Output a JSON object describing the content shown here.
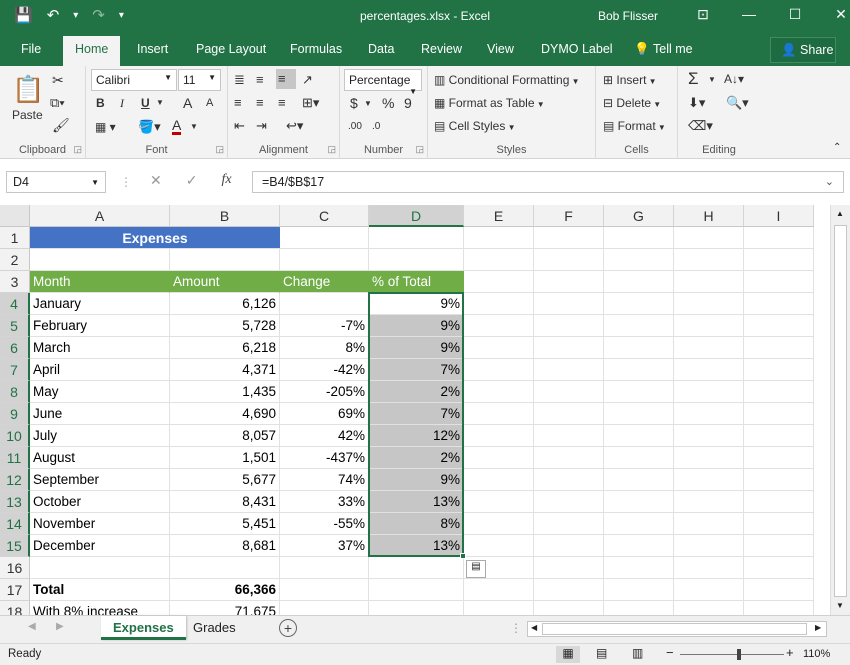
{
  "window": {
    "title": "percentages.xlsx - Excel",
    "user": "Bob Flisser",
    "controls": [
      "⊡",
      "—",
      "☐",
      "✕"
    ]
  },
  "qat": {
    "save": "💾",
    "undo": "↶",
    "undo_drop": "▾",
    "redo": "↷",
    "more": "▾"
  },
  "ribbon_tabs": [
    "File",
    "Home",
    "Insert",
    "Page Layout",
    "Formulas",
    "Data",
    "Review",
    "View",
    "DYMO Label",
    "Tell me"
  ],
  "tell_me_icon": "💡",
  "share_label": "Share",
  "ribbon": {
    "clipboard": {
      "label": "Clipboard",
      "paste": "Paste"
    },
    "font": {
      "label": "Font",
      "name": "Calibri",
      "size": "11",
      "bold": "B",
      "italic": "I",
      "underline": "U",
      "grow": "A",
      "shrink": "A"
    },
    "alignment": {
      "label": "Alignment"
    },
    "number": {
      "label": "Number",
      "format": "Percentage",
      "currency": "$",
      "percent": "%",
      "comma": "9",
      "inc": ".00",
      "dec": ".0"
    },
    "styles": {
      "label": "Styles",
      "conditional": "Conditional Formatting",
      "table": "Format as Table",
      "cell_styles": "Cell Styles"
    },
    "cells": {
      "label": "Cells",
      "insert": "Insert",
      "delete": "Delete",
      "format": "Format"
    },
    "editing": {
      "label": "Editing",
      "sum": "Σ"
    }
  },
  "formula_bar": {
    "name_box": "D4",
    "fx": "fx",
    "formula": "=B4/$B$17"
  },
  "columns": [
    "A",
    "B",
    "C",
    "D",
    "E",
    "F",
    "G",
    "H",
    "I"
  ],
  "rows": [
    "1",
    "2",
    "3",
    "4",
    "5",
    "6",
    "7",
    "8",
    "9",
    "10",
    "11",
    "12",
    "13",
    "14",
    "15",
    "16",
    "17",
    "18"
  ],
  "sheet": {
    "title": "Expenses",
    "headers": [
      "Month",
      "Amount",
      "Change",
      "% of Total"
    ],
    "data": [
      [
        "January",
        "6,126",
        "",
        "9%"
      ],
      [
        "February",
        "5,728",
        "-7%",
        "9%"
      ],
      [
        "March",
        "6,218",
        "8%",
        "9%"
      ],
      [
        "April",
        "4,371",
        "-42%",
        "7%"
      ],
      [
        "May",
        "1,435",
        "-205%",
        "2%"
      ],
      [
        "June",
        "4,690",
        "69%",
        "7%"
      ],
      [
        "July",
        "8,057",
        "42%",
        "12%"
      ],
      [
        "August",
        "1,501",
        "-437%",
        "2%"
      ],
      [
        "September",
        "5,677",
        "74%",
        "9%"
      ],
      [
        "October",
        "8,431",
        "33%",
        "13%"
      ],
      [
        "November",
        "5,451",
        "-55%",
        "8%"
      ],
      [
        "December",
        "8,681",
        "37%",
        "13%"
      ]
    ],
    "total_label": "Total",
    "total_value": "66,366",
    "increase_label": "With 8% increase",
    "increase_value": "71,675"
  },
  "sheet_tabs": [
    "Expenses",
    "Grades"
  ],
  "status": {
    "text": "Ready",
    "zoom": "110%"
  },
  "colors": {
    "excel_green": "#217346",
    "title_fill": "#4472c4",
    "header_fill": "#70ad47",
    "selection": "#c6c6c6"
  }
}
